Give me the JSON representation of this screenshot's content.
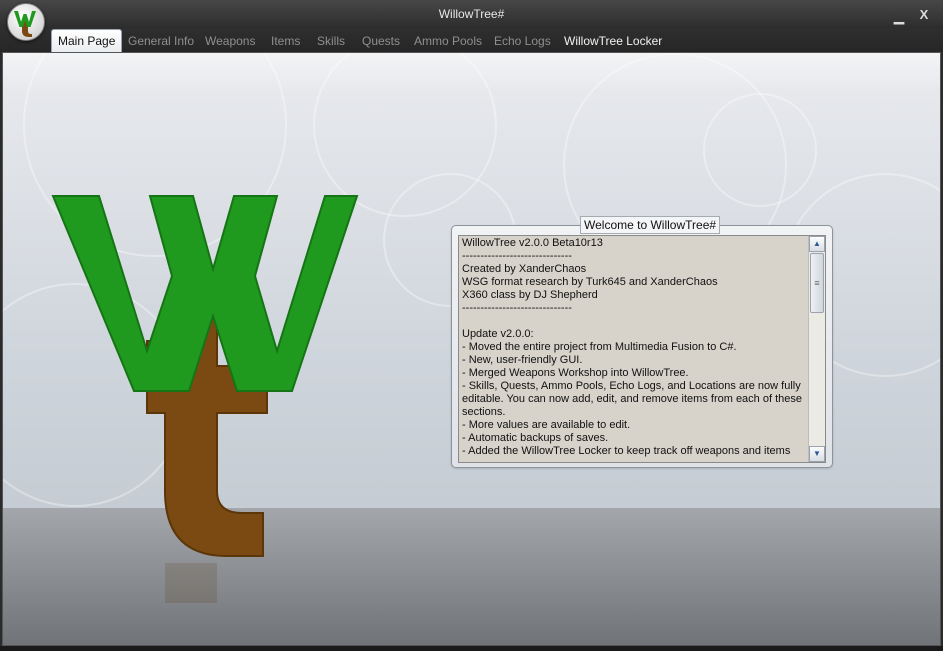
{
  "window": {
    "title": "WillowTree#",
    "minimize_glyph": "▁",
    "close_glyph": "X",
    "app_icon": "willowtree-logo-icon"
  },
  "tabs": [
    {
      "label": "Main Page",
      "state": "active"
    },
    {
      "label": "General Info",
      "state": "disabled"
    },
    {
      "label": "Weapons",
      "state": "disabled"
    },
    {
      "label": "Items",
      "state": "disabled"
    },
    {
      "label": "Skills",
      "state": "disabled"
    },
    {
      "label": "Quests",
      "state": "disabled"
    },
    {
      "label": "Ammo Pools",
      "state": "disabled"
    },
    {
      "label": "Echo Logs",
      "state": "disabled"
    },
    {
      "label": "WillowTree Locker",
      "state": "enabled"
    }
  ],
  "welcome": {
    "group_title": "Welcome to WillowTree#",
    "lines": [
      "WillowTree v2.0.0 Beta10r13",
      "------------------------------",
      "Created by XanderChaos",
      "WSG format research by Turk645 and XanderChaos",
      "X360 class by DJ Shepherd",
      "------------------------------",
      "",
      "Update v2.0.0:",
      "- Moved the entire project from Multimedia Fusion to C#.",
      "- New, user-friendly GUI.",
      "- Merged Weapons Workshop into WillowTree.",
      "- Skills, Quests, Ammo Pools, Echo Logs, and Locations are now fully editable. You can now add, edit, and remove items from each of these sections.",
      "- More values are available to edit.",
      "- Automatic backups of saves.",
      "- Added the WillowTree Locker to keep track off weapons and items"
    ],
    "scroll_up_glyph": "▲",
    "scroll_down_glyph": "▼",
    "scroll_thumb_glyph": "≡"
  },
  "colors": {
    "logo_green": "#1f9a1f",
    "logo_brown": "#7a4a12",
    "accent_blue": "#2c5a94"
  }
}
